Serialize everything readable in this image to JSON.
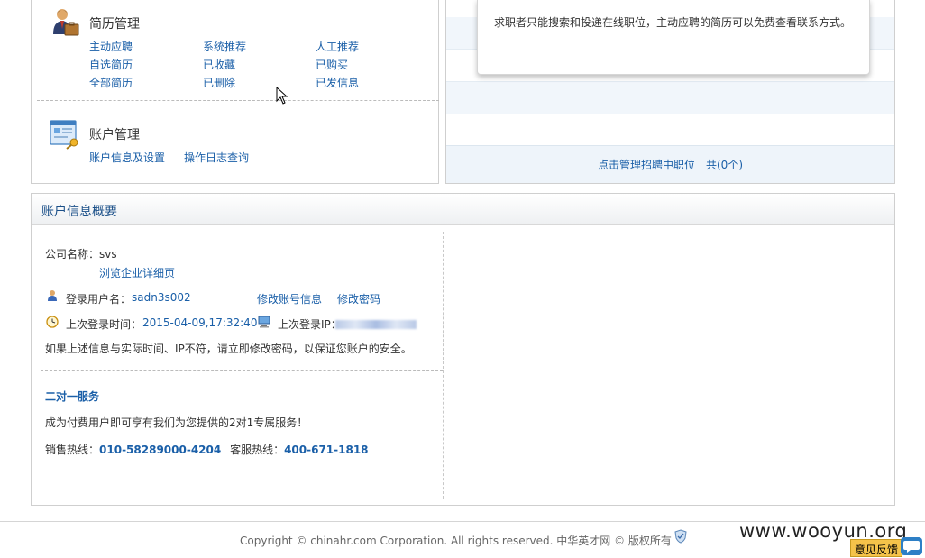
{
  "resume_mgmt": {
    "title": "简历管理",
    "links": [
      "主动应聘",
      "系统推荐",
      "人工推荐",
      "自选简历",
      "已收藏",
      "已购买",
      "全部简历",
      "已删除",
      "已发信息"
    ]
  },
  "account_mgmt": {
    "title": "账户管理",
    "links": [
      "账户信息及设置",
      "操作日志查询"
    ]
  },
  "job_panel": {
    "popup_text": "求职者只能搜索和投递在线职位，主动应聘的简历可以免费查看联系方式。",
    "manage_link": "点击管理招聘中职位",
    "count": "共(0个)"
  },
  "account_overview": {
    "header": "账户信息概要",
    "company_label": "公司名称：",
    "company_value": "svs",
    "browse_link": "浏览企业详细页",
    "username_label": "登录用户名：",
    "username_value": "sadn3s002",
    "edit_account_link": "修改账号信息",
    "change_password_link": "修改密码",
    "last_login_time_label": "上次登录时间：",
    "last_login_time_value": "2015-04-09,17:32:40",
    "last_login_ip_label": "上次登录IP：",
    "security_note": "如果上述信息与实际时间、IP不符，请立即修改密码，以保证您账户的安全。",
    "service_title": "二对一服务",
    "service_desc": "成为付费用户即可享有我们为您提供的2对1专属服务！",
    "sales_label": "销售热线：",
    "sales_phone": "010-58289000-4204",
    "support_label": "客服热线：",
    "support_phone": "400-671-1818"
  },
  "footer": {
    "copyright": "Copyright © chinahr.com Corporation. All rights reserved. 中华英才网 © 版权所有",
    "watermark": "www.wooyun.org",
    "feedback": "意见反馈"
  }
}
